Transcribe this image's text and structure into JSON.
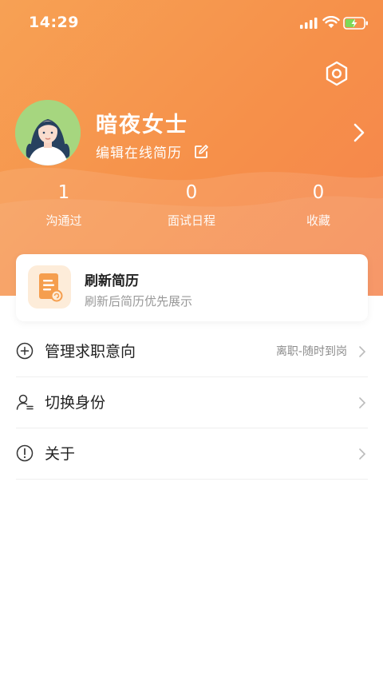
{
  "status_bar": {
    "time": "14:29"
  },
  "profile": {
    "name": "暗夜女士",
    "edit_resume_label": "编辑在线简历"
  },
  "stats": [
    {
      "value": "1",
      "label": "沟通过"
    },
    {
      "value": "0",
      "label": "面试日程"
    },
    {
      "value": "0",
      "label": "收藏"
    }
  ],
  "refresh_card": {
    "title": "刷新简历",
    "subtitle": "刷新后简历优先展示"
  },
  "menu": [
    {
      "icon": "plus-circle-icon",
      "label": "管理求职意向",
      "value": "离职-随时到岗"
    },
    {
      "icon": "switch-user-icon",
      "label": "切换身份",
      "value": ""
    },
    {
      "icon": "info-circle-icon",
      "label": "关于",
      "value": ""
    }
  ],
  "colors": {
    "header_start": "#f7a154",
    "header_end": "#f5844c",
    "card_icon_bg": "#fdecd9"
  }
}
